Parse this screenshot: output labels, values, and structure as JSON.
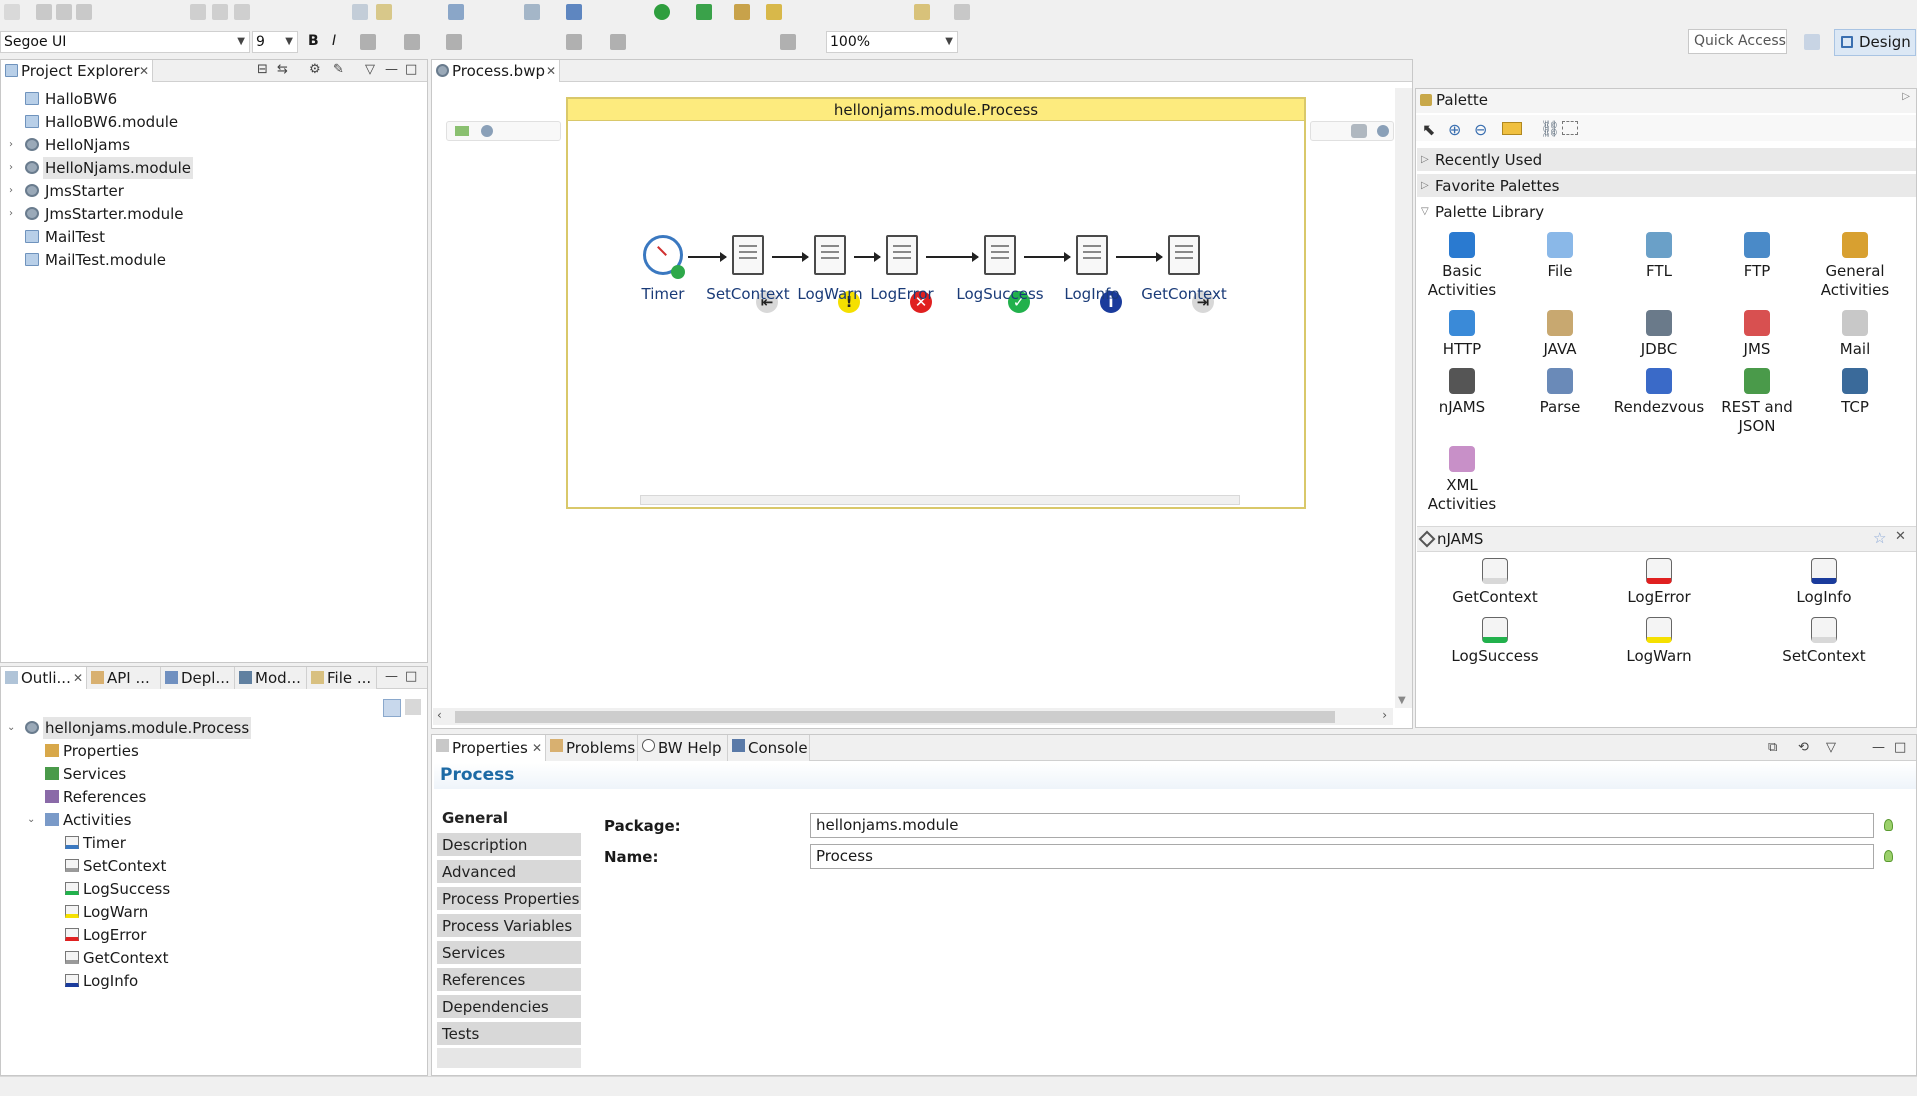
{
  "toolbar": {
    "font_name": "Segoe UI",
    "font_size": "9",
    "bold": "B",
    "italic": "I",
    "zoom": "100%",
    "quick_access_placeholder": "Quick Access",
    "design_label": "Design"
  },
  "project_explorer": {
    "title": "Project Explorer",
    "items": [
      {
        "label": "HalloBW6",
        "expandable": false
      },
      {
        "label": "HalloBW6.module",
        "expandable": false
      },
      {
        "label": "HelloNjams",
        "expandable": true
      },
      {
        "label": "HelloNjams.module",
        "expandable": true,
        "selected": true
      },
      {
        "label": "JmsStarter",
        "expandable": true
      },
      {
        "label": "JmsStarter.module",
        "expandable": true
      },
      {
        "label": "MailTest",
        "expandable": false
      },
      {
        "label": "MailTest.module",
        "expandable": false
      }
    ]
  },
  "outline": {
    "tabs": [
      "Outli...",
      "API ...",
      "Depl...",
      "Mod...",
      "File ..."
    ],
    "root": "hellonjams.module.Process",
    "nodes": [
      "Properties",
      "Services",
      "References",
      "Activities"
    ],
    "activities": [
      "Timer",
      "SetContext",
      "LogSuccess",
      "LogWarn",
      "LogError",
      "GetContext",
      "LogInfo"
    ]
  },
  "editor": {
    "tab_title": "Process.bwp",
    "process_title": "hellonjams.module.Process",
    "activities": [
      "Timer",
      "SetContext",
      "LogWarn",
      "LogError",
      "LogSuccess",
      "LogInfo",
      "GetContext"
    ]
  },
  "palette": {
    "title": "Palette",
    "sections": [
      "Recently Used",
      "Favorite Palettes",
      "Palette Library"
    ],
    "library": [
      "Basic Activities",
      "File",
      "FTL",
      "FTP",
      "General Activities",
      "HTTP",
      "JAVA",
      "JDBC",
      "JMS",
      "Mail",
      "nJAMS",
      "Parse",
      "Rendezvous",
      "REST and JSON",
      "TCP",
      "XML Activities"
    ],
    "njams_title": "nJAMS",
    "njams_items": [
      "GetContext",
      "LogError",
      "LogInfo",
      "LogSuccess",
      "LogWarn",
      "SetContext"
    ]
  },
  "properties": {
    "tabs": [
      "Properties",
      "Problems",
      "BW Help",
      "Console"
    ],
    "heading": "Process",
    "side_tabs": [
      "General",
      "Description",
      "Advanced",
      "Process Properties",
      "Process Variables",
      "Services",
      "References",
      "Dependencies",
      "Tests"
    ],
    "package_label": "Package:",
    "package_value": "hellonjams.module",
    "name_label": "Name:",
    "name_value": "Process"
  },
  "colors": {
    "process_header": "#fdeb7e",
    "process_border": "#d9c86a",
    "link_blue": "#1a3b78",
    "error_red": "#e02020",
    "success_green": "#22b14c",
    "warn_yellow": "#f5e000",
    "info_blue": "#1a3b9c",
    "properties_heading": "#1d6aa5"
  }
}
